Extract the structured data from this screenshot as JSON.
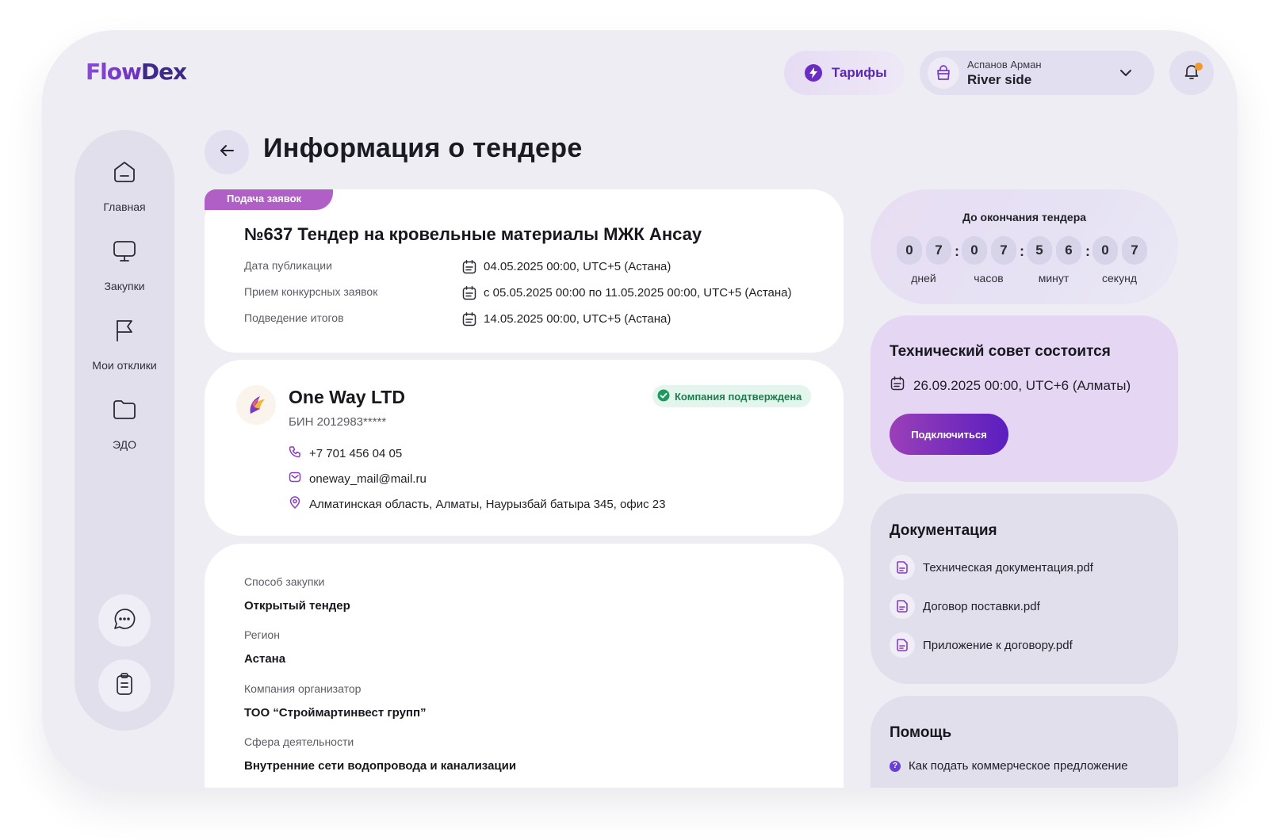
{
  "logo": {
    "part1": "Flow",
    "part2": "Dex"
  },
  "header": {
    "tariffs_label": "Тарифы",
    "user_name": "Аспанов Арман",
    "company_name": "River side"
  },
  "sidebar": {
    "items": [
      {
        "label": "Главная",
        "icon": "home-icon"
      },
      {
        "label": "Закупки",
        "icon": "monitor-icon"
      },
      {
        "label": "Мои отклики",
        "icon": "flag-icon"
      },
      {
        "label": "ЭДО",
        "icon": "folder-icon"
      }
    ],
    "bottom_icons": [
      "chat-icon",
      "clipboard-icon"
    ]
  },
  "page": {
    "title": "Информация о тендере"
  },
  "tender": {
    "status": "Подача заявок",
    "title": "№637 Тендер на кровельные материалы МЖК Ансау",
    "rows": [
      {
        "key": "Дата публикации",
        "value": "04.05.2025 00:00, UTC+5 (Астана)"
      },
      {
        "key": "Прием конкурсных заявок",
        "value": "с 05.05.2025 00:00 по 11.05.2025 00:00, UTC+5 (Астана)"
      },
      {
        "key": "Подведение итогов",
        "value": "14.05.2025 00:00, UTC+5 (Астана)"
      }
    ]
  },
  "company": {
    "name": "One Way LTD",
    "bin": "БИН 2012983*****",
    "verified_label": "Компания подтверждена",
    "phone": "+7 701 456 04 05",
    "email": "oneway_mail@mail.ru",
    "address": "Алматинская область, Алматы, Наурызбай батыра 345, офис 23"
  },
  "details": [
    {
      "key": "Способ закупки",
      "value": "Открытый тендер"
    },
    {
      "key": "Регион",
      "value": "Астана"
    },
    {
      "key": "Компания организатор",
      "value": "ТОО “Строймартинвест групп”"
    },
    {
      "key": "Сфера деятельности",
      "value": "Внутренние сети водопровода и канализации"
    }
  ],
  "timer": {
    "title": "До окончания тендера",
    "digits": [
      "0",
      "7",
      "0",
      "7",
      "5",
      "6",
      "0",
      "7"
    ],
    "separator": ":",
    "units": [
      "дней",
      "часов",
      "минут",
      "секунд"
    ]
  },
  "council": {
    "title": "Технический совет состоится",
    "date": "26.09.2025 00:00, UTC+6 (Алматы)",
    "join_label": "Подключиться"
  },
  "docs": {
    "title": "Документация",
    "items": [
      "Техническая документация.pdf",
      "Договор поставки.pdf",
      "Приложение к договору.pdf"
    ]
  },
  "help": {
    "title": "Помощь",
    "items": [
      "Как подать коммерческое предложение"
    ]
  },
  "colors": {
    "accent": "#6a2cc4",
    "tag": "#b05fc7",
    "verified": "#1f7a4d",
    "notify": "#f09a2a"
  }
}
